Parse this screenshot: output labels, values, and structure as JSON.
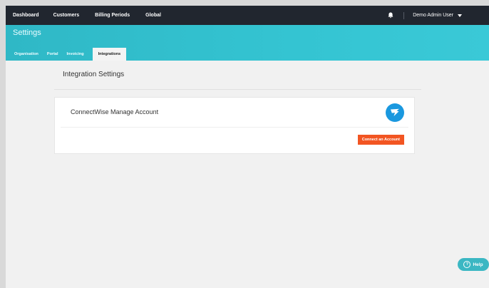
{
  "topnav": {
    "items": [
      "Dashboard",
      "Customers",
      "Billing Periods",
      "Global"
    ],
    "user_label": "Demo Admin User"
  },
  "header": {
    "title": "Settings",
    "tabs": [
      {
        "label": "Organisation"
      },
      {
        "label": "Portal"
      },
      {
        "label": "Invoicing"
      },
      {
        "label": "Integrations"
      }
    ]
  },
  "main": {
    "section_title": "Integration Settings",
    "card": {
      "title": "ConnectWise Manage Account",
      "connect_label": "Connect an Account"
    }
  },
  "help": {
    "label": "Help"
  },
  "colors": {
    "accent": "#34c4d2",
    "nav": "#21262f",
    "button": "#f25522"
  },
  "icons": [
    "bell-icon",
    "chevron-down-icon",
    "connectwise-logo-icon",
    "help-icon"
  ]
}
